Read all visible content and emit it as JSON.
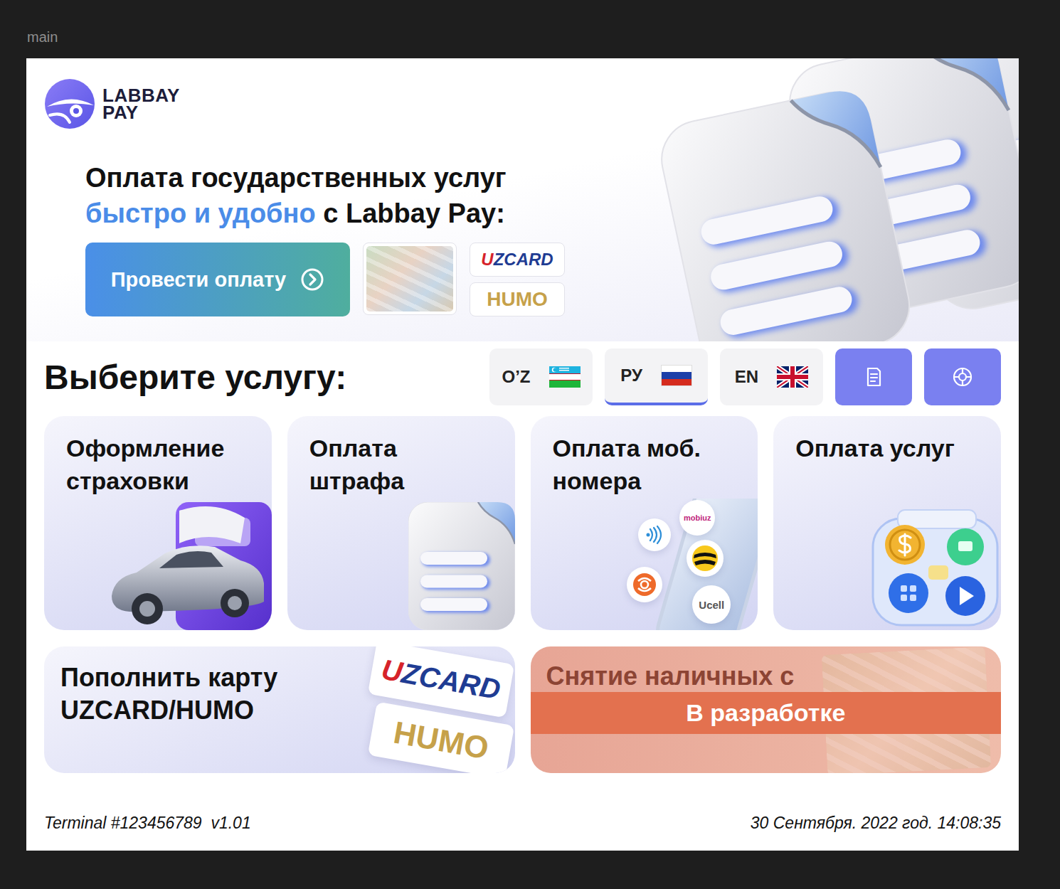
{
  "canvas": {
    "label": "main"
  },
  "logo": {
    "line1": "LABBAY",
    "line2": "PAY"
  },
  "hero": {
    "title": "Оплата государственных услуг",
    "subtitle_highlight": "быстро и удобно",
    "subtitle_rest": " с Labbay Pay:",
    "pay_button": "Провести оплату",
    "payment_cards": [
      {
        "label": "UZCARD",
        "kind": "uzcard"
      },
      {
        "label": "HUMO",
        "kind": "humo"
      }
    ]
  },
  "services_heading": "Выберите услугу:",
  "languages": [
    {
      "label": "O’Z",
      "kind": "uz",
      "selected": false
    },
    {
      "label": "РУ",
      "kind": "ru",
      "selected": true
    },
    {
      "label": "EN",
      "kind": "gb",
      "selected": false
    }
  ],
  "services": [
    {
      "kind": "insurance",
      "lines": [
        "Оформление",
        "страховки"
      ]
    },
    {
      "kind": "fine",
      "lines": [
        "Оплата",
        "штрафа"
      ]
    },
    {
      "kind": "mobile",
      "lines": [
        "Оплата моб.",
        "номера"
      ],
      "operators": [
        "mobiuz",
        "Ucell"
      ]
    },
    {
      "kind": "utilities",
      "lines": [
        "Оплата услуг"
      ]
    }
  ],
  "wide_services": [
    {
      "kind": "topup",
      "lines": [
        "Пополнить карту",
        "UZCARD/HUMO"
      ],
      "cards": [
        "UZCARD",
        "HUMO"
      ],
      "disabled": false
    },
    {
      "kind": "cash_withdrawal",
      "lines": [
        "Снятие наличных с"
      ],
      "badge": "В разработке",
      "disabled": true
    }
  ],
  "footer": {
    "terminal": "Terminal #123456789  v1.01",
    "datetime": "30 Сентября. 2022 год. 14:08:35"
  }
}
